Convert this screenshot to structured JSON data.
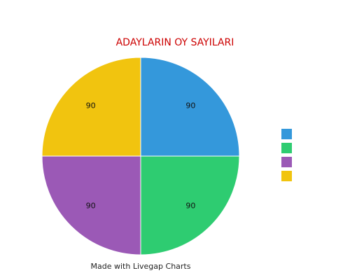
{
  "chart_data": {
    "type": "pie",
    "title": "ADAYLARIN OY SAYILARI",
    "slices": [
      {
        "label": "",
        "value": 90,
        "color": "#3498db"
      },
      {
        "label": "",
        "value": 90,
        "color": "#2ecc71"
      },
      {
        "label": "",
        "value": 90,
        "color": "#9b59b6"
      },
      {
        "label": "",
        "value": 90,
        "color": "#f1c40f"
      }
    ],
    "data_labels": [
      "90",
      "90",
      "90",
      "90"
    ],
    "legend_position": "right",
    "start_angle": "12 o'clock, clockwise"
  },
  "footer": {
    "credit": "Made with Livegap Charts"
  }
}
